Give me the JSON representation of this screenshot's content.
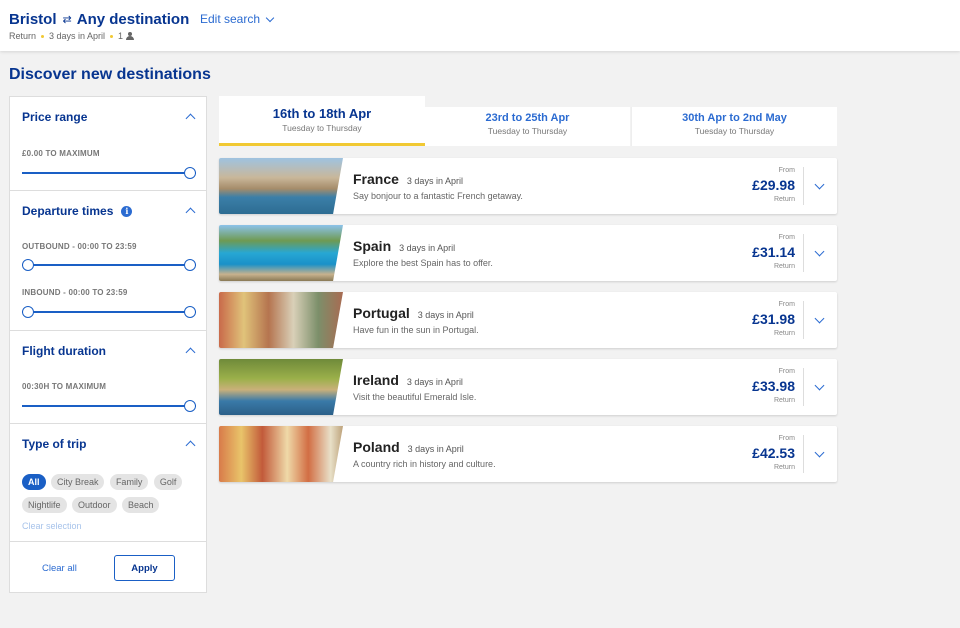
{
  "header": {
    "origin": "Bristol",
    "destination": "Any destination",
    "swap_icon": "two-way-arrows-icon",
    "edit_search": "Edit search",
    "trip_type": "Return",
    "duration": "3 days in April",
    "passengers": "1",
    "passenger_icon": "person-icon"
  },
  "page_title": "Discover new destinations",
  "filters": {
    "price_range": {
      "title": "Price range",
      "label": "£0.00 TO MAXIMUM",
      "value_fraction": 1.0
    },
    "departure_times": {
      "title": "Departure times",
      "info_icon": "i",
      "outbound_label": "OUTBOUND - 00:00 TO 23:59",
      "outbound_range": [
        0,
        1
      ],
      "inbound_label": "INBOUND - 00:00 TO 23:59",
      "inbound_range": [
        0,
        1
      ]
    },
    "flight_duration": {
      "title": "Flight duration",
      "label": "00:30H TO MAXIMUM",
      "value_fraction": 1.0
    },
    "type_of_trip": {
      "title": "Type of trip",
      "chips": [
        "All",
        "City Break",
        "Family",
        "Golf",
        "Nightlife",
        "Outdoor",
        "Beach"
      ],
      "selected": "All",
      "clear_selection": "Clear selection"
    },
    "clear_all": "Clear all",
    "apply": "Apply"
  },
  "date_tabs": [
    {
      "dates": "16th to 18th Apr",
      "days": "Tuesday to Thursday",
      "active": true
    },
    {
      "dates": "23rd to 25th Apr",
      "days": "Tuesday to Thursday",
      "active": false
    },
    {
      "dates": "30th Apr to 2nd May",
      "days": "Tuesday to Thursday",
      "active": false
    }
  ],
  "destinations": [
    {
      "country": "France",
      "duration": "3 days in April",
      "description": "Say bonjour to a fantastic French getaway.",
      "from": "From",
      "price": "£29.98",
      "return": "Return"
    },
    {
      "country": "Spain",
      "duration": "3 days in April",
      "description": "Explore the best Spain has to offer.",
      "from": "From",
      "price": "£31.14",
      "return": "Return"
    },
    {
      "country": "Portugal",
      "duration": "3 days in April",
      "description": "Have fun in the sun in Portugal.",
      "from": "From",
      "price": "£31.98",
      "return": "Return"
    },
    {
      "country": "Ireland",
      "duration": "3 days in April",
      "description": "Visit the beautiful Emerald Isle.",
      "from": "From",
      "price": "£33.98",
      "return": "Return"
    },
    {
      "country": "Poland",
      "duration": "3 days in April",
      "description": "A country rich in history and culture.",
      "from": "From",
      "price": "£42.53",
      "return": "Return"
    }
  ],
  "colors": {
    "brand_navy": "#073590",
    "accent_blue": "#2b6bd1",
    "slider_blue": "#1a5fc5",
    "accent_yellow": "#f1c933",
    "background": "#f2f2f2"
  }
}
